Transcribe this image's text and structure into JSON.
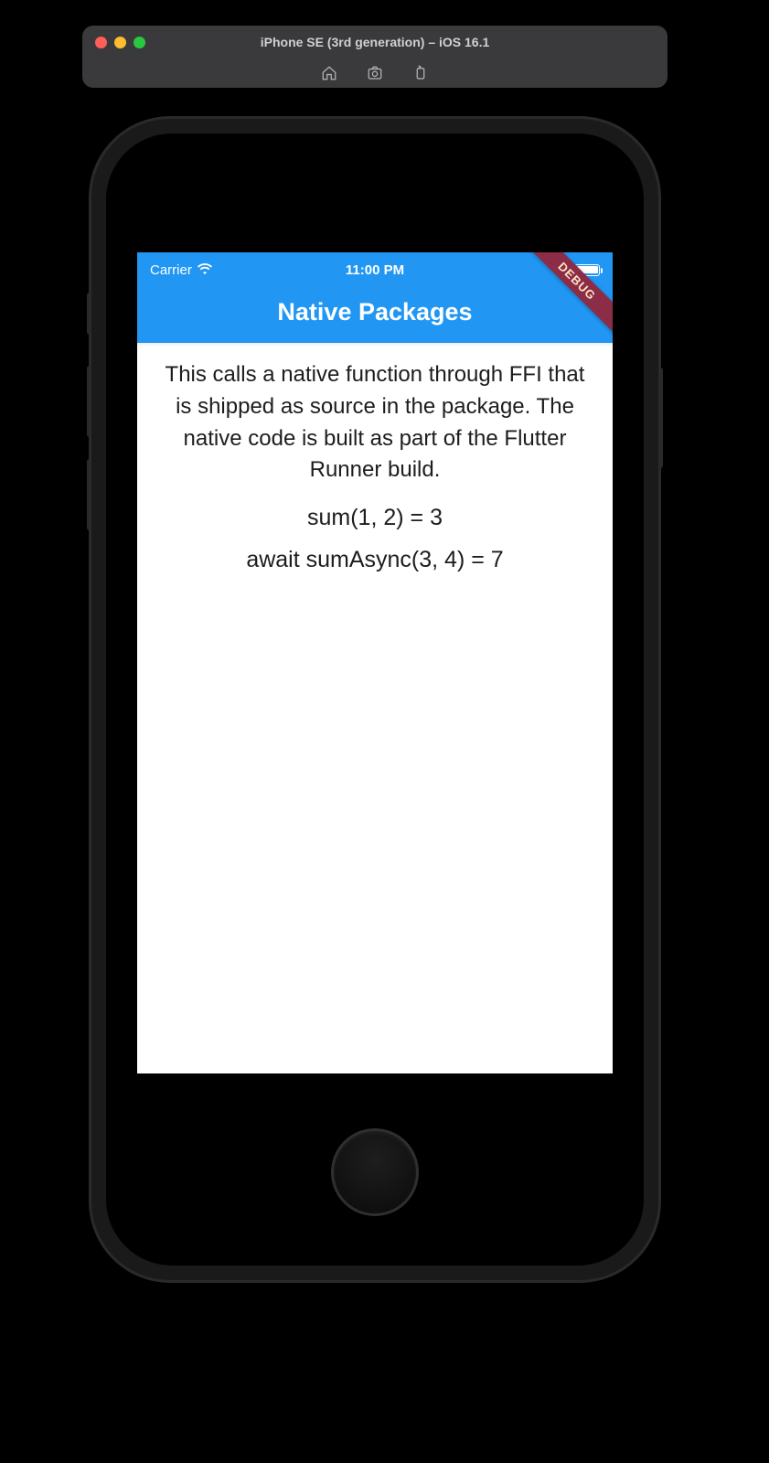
{
  "simulator": {
    "title": "iPhone SE (3rd generation) – iOS 16.1",
    "toolbar": {
      "home": "home-icon",
      "screenshot": "screenshot-icon",
      "rotate": "rotate-icon"
    }
  },
  "status_bar": {
    "carrier": "Carrier",
    "time": "11:00 PM"
  },
  "app_bar": {
    "title": "Native Packages"
  },
  "debug_banner": "DEBUG",
  "body": {
    "description": "This calls a native function through FFI that is shipped as source in the package. The native code is built as part of the Flutter Runner build.",
    "line1": "sum(1, 2) = 3",
    "line2": "await sumAsync(3, 4) = 7"
  }
}
